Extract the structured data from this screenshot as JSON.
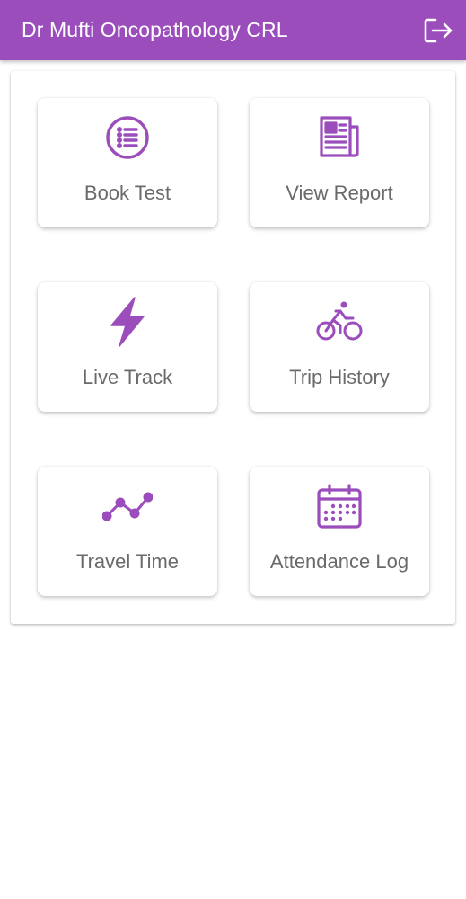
{
  "header": {
    "title": "Dr Mufti Oncopathology CRL",
    "logout_icon": "logout-icon",
    "background": "#9a4dbb"
  },
  "accent_color": "#9a4dbb",
  "tiles": [
    {
      "label": "Book Test",
      "icon": "list-circle-icon"
    },
    {
      "label": "View Report",
      "icon": "newspaper-icon"
    },
    {
      "label": "Live Track",
      "icon": "lightning-bolt-icon"
    },
    {
      "label": "Trip History",
      "icon": "bicycle-rider-icon"
    },
    {
      "label": "Travel Time",
      "icon": "line-chart-icon"
    },
    {
      "label": "Attendance Log",
      "icon": "calendar-icon"
    }
  ]
}
